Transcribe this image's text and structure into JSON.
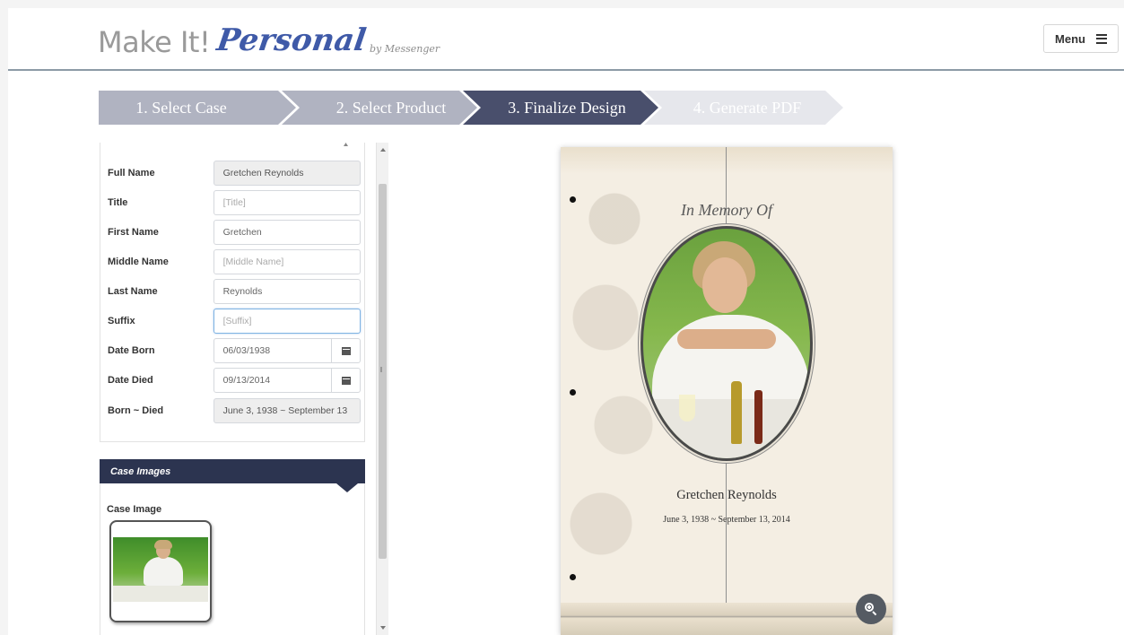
{
  "header": {
    "logo_make": "Make It!",
    "logo_personal": "Personal",
    "logo_by": "by Messenger",
    "menu_label": "Menu"
  },
  "steps": [
    {
      "label": "1. Select Case",
      "state": "done"
    },
    {
      "label": "2. Select Product",
      "state": "done"
    },
    {
      "label": "3. Finalize Design",
      "state": "active"
    },
    {
      "label": "4. Generate PDF",
      "state": "pending"
    }
  ],
  "form": {
    "full_name": {
      "label": "Full Name",
      "value": "Gretchen Reynolds"
    },
    "title": {
      "label": "Title",
      "placeholder": "[Title]"
    },
    "first_name": {
      "label": "First Name",
      "value": "Gretchen"
    },
    "middle_name": {
      "label": "Middle Name",
      "placeholder": "[Middle Name]"
    },
    "last_name": {
      "label": "Last Name",
      "value": "Reynolds"
    },
    "suffix": {
      "label": "Suffix",
      "placeholder": "[Suffix]"
    },
    "date_born": {
      "label": "Date Born",
      "value": "06/03/1938"
    },
    "date_died": {
      "label": "Date Died",
      "value": "09/13/2014"
    },
    "born_died": {
      "label": "Born ~ Died",
      "value": "June 3, 1938 ~ September 13"
    }
  },
  "case_images": {
    "header": "Case Images",
    "image_label": "Case Image"
  },
  "preview": {
    "heading": "In Memory Of",
    "name": "Gretchen Reynolds",
    "dates": "June 3, 1938 ~ September 13, 2014"
  },
  "colors": {
    "step_done": "#b0b3c1",
    "step_active": "#494f6c",
    "step_pending": "#e6e7ec",
    "panel_header": "#2c3450",
    "logo_accent": "#3f5aa8"
  }
}
